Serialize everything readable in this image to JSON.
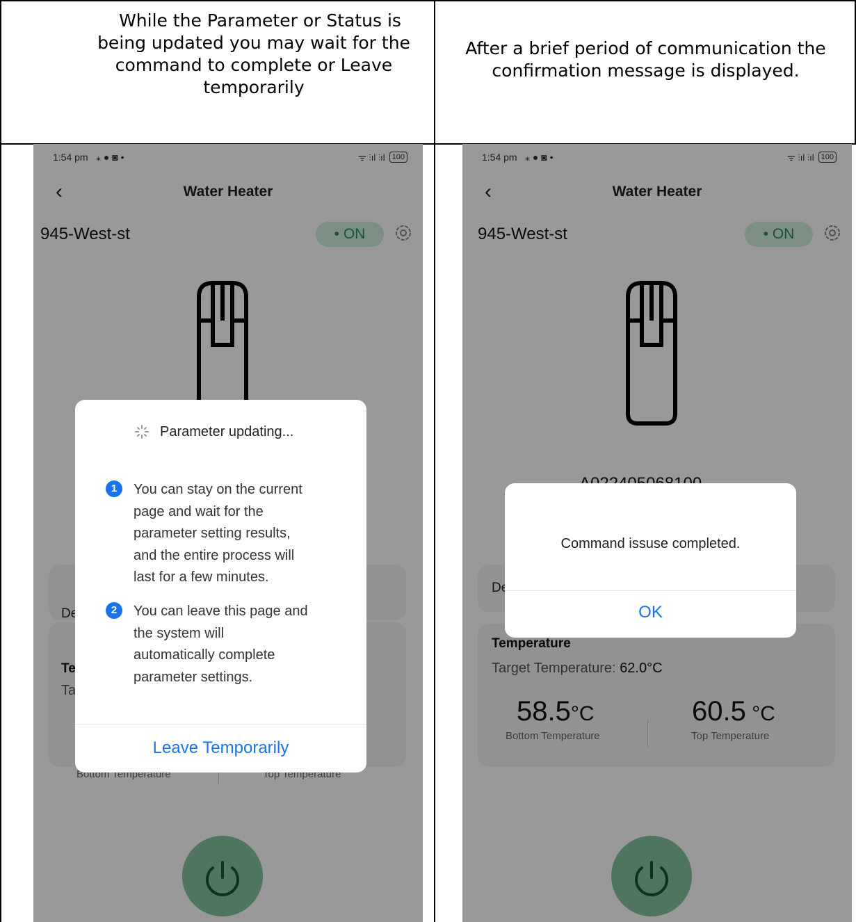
{
  "captions": {
    "left": [
      "While the Parameter or Status is",
      "being updated you may wait for the",
      "command to complete or Leave",
      "temporarily"
    ],
    "right": [
      "After a brief period of communication the",
      "confirmation message is displayed."
    ]
  },
  "phone_left": {
    "status_time": "1:54 pm",
    "status_icons": "⁎ ● ◙ •",
    "signal": "ᯤ ⫶ıl ⫶ıl",
    "battery": "100",
    "header_title": "Water Heater",
    "device_name": "945-West-st",
    "power_status": "• ON",
    "card_partial_label": "De",
    "temperature_partial_title": "Te",
    "target_partial": "Ta",
    "bottom_label": "Bottom Temperature",
    "top_label": "Top Temperature",
    "dialog": {
      "title": "Parameter updating...",
      "steps": [
        {
          "num": "1",
          "lines": [
            "You can stay on the current",
            "page and wait for the",
            "parameter setting results,",
            "and the entire process will",
            "last for a few minutes."
          ]
        },
        {
          "num": "2",
          "lines": [
            "You can leave this page and",
            "the system will",
            "automatically complete",
            "parameter settings."
          ]
        }
      ],
      "button": "Leave Temporarily"
    }
  },
  "phone_right": {
    "status_time": "1:54 pm",
    "status_icons": "⁎ ● ◙ •",
    "signal": "ᯤ ⫶ıl ⫶ıl",
    "battery": "100",
    "header_title": "Water Heater",
    "device_name": "945-West-st",
    "power_status": "• ON",
    "serial_partial": "A022405068100",
    "card_partial_label": "De",
    "temperature_title": "Temperature",
    "target_label": "Target Temperature:",
    "target_value": "62.0°C",
    "bottom_value": "58.5",
    "bottom_unit": "°C",
    "bottom_label": "Bottom Temperature",
    "top_value": "60.5",
    "top_unit": " °C",
    "top_label": "Top Temperature",
    "dialog": {
      "message": "Command issuse completed.",
      "button": "OK"
    }
  }
}
